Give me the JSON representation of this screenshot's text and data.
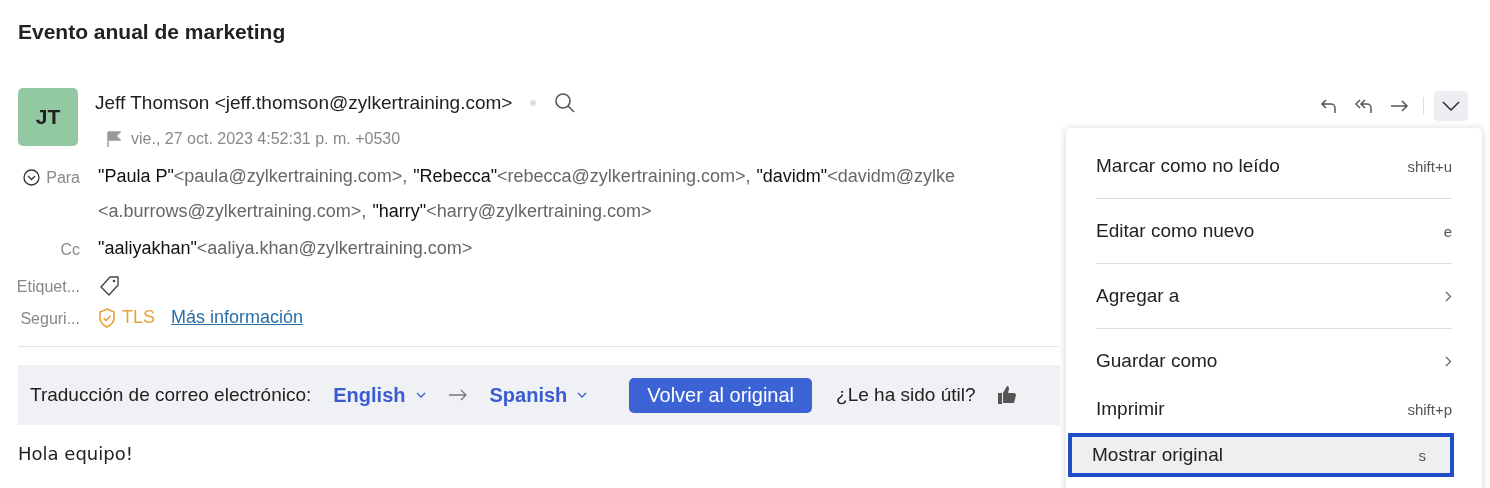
{
  "subject": "Evento anual de marketing",
  "sender": {
    "initials": "JT",
    "display": "Jeff Thomson <jeff.thomson@zylkertraining.com>",
    "date": "vie., 27 oct. 2023 4:52:31 p. m. +0530"
  },
  "to": {
    "label": "Para",
    "lines": [
      [
        {
          "name": "\"Paula P\"",
          "email": "<paula@zylkertraining.com>,"
        },
        {
          "name": "\"Rebecca\"",
          "email": "<rebecca@zylkertraining.com>,"
        },
        {
          "name": "\"davidm\"",
          "email": "<davidm@zylke"
        }
      ],
      [
        {
          "email": "<a.burrows@zylkertraining.com>,"
        },
        {
          "name": "\"harry\"",
          "email": "<harry@zylkertraining.com>"
        }
      ]
    ]
  },
  "cc": {
    "label": "Cc",
    "lines": [
      [
        {
          "name": "\"aaliyakhan\"",
          "email": "<aaliya.khan@zylkertraining.com>"
        }
      ]
    ]
  },
  "labels_row": {
    "label": "Etiquet..."
  },
  "security_row": {
    "label": "Seguri...",
    "protocol": "TLS",
    "link": "Más información"
  },
  "translation": {
    "label": "Traducción de correo electrónico:",
    "from": "English",
    "to": "Spanish",
    "button": "Volver al original",
    "feedback": "¿Le ha sido útil?"
  },
  "body": "Hola equipo!",
  "menu": [
    {
      "label": "Marcar como no leído",
      "shortcut": "shift+u",
      "kind": "shortcut",
      "selected": false
    },
    {
      "label": "Editar como nuevo",
      "shortcut": "e",
      "kind": "shortcut",
      "selected": false
    },
    {
      "label": "Agregar a",
      "kind": "submenu",
      "selected": false
    },
    {
      "label": "Guardar como",
      "kind": "submenu",
      "selected": false
    },
    {
      "label": "Imprimir",
      "shortcut": "shift+p",
      "kind": "shortcut",
      "selected": false
    },
    {
      "label": "Mostrar original",
      "shortcut": "s",
      "kind": "shortcut",
      "selected": true
    }
  ]
}
